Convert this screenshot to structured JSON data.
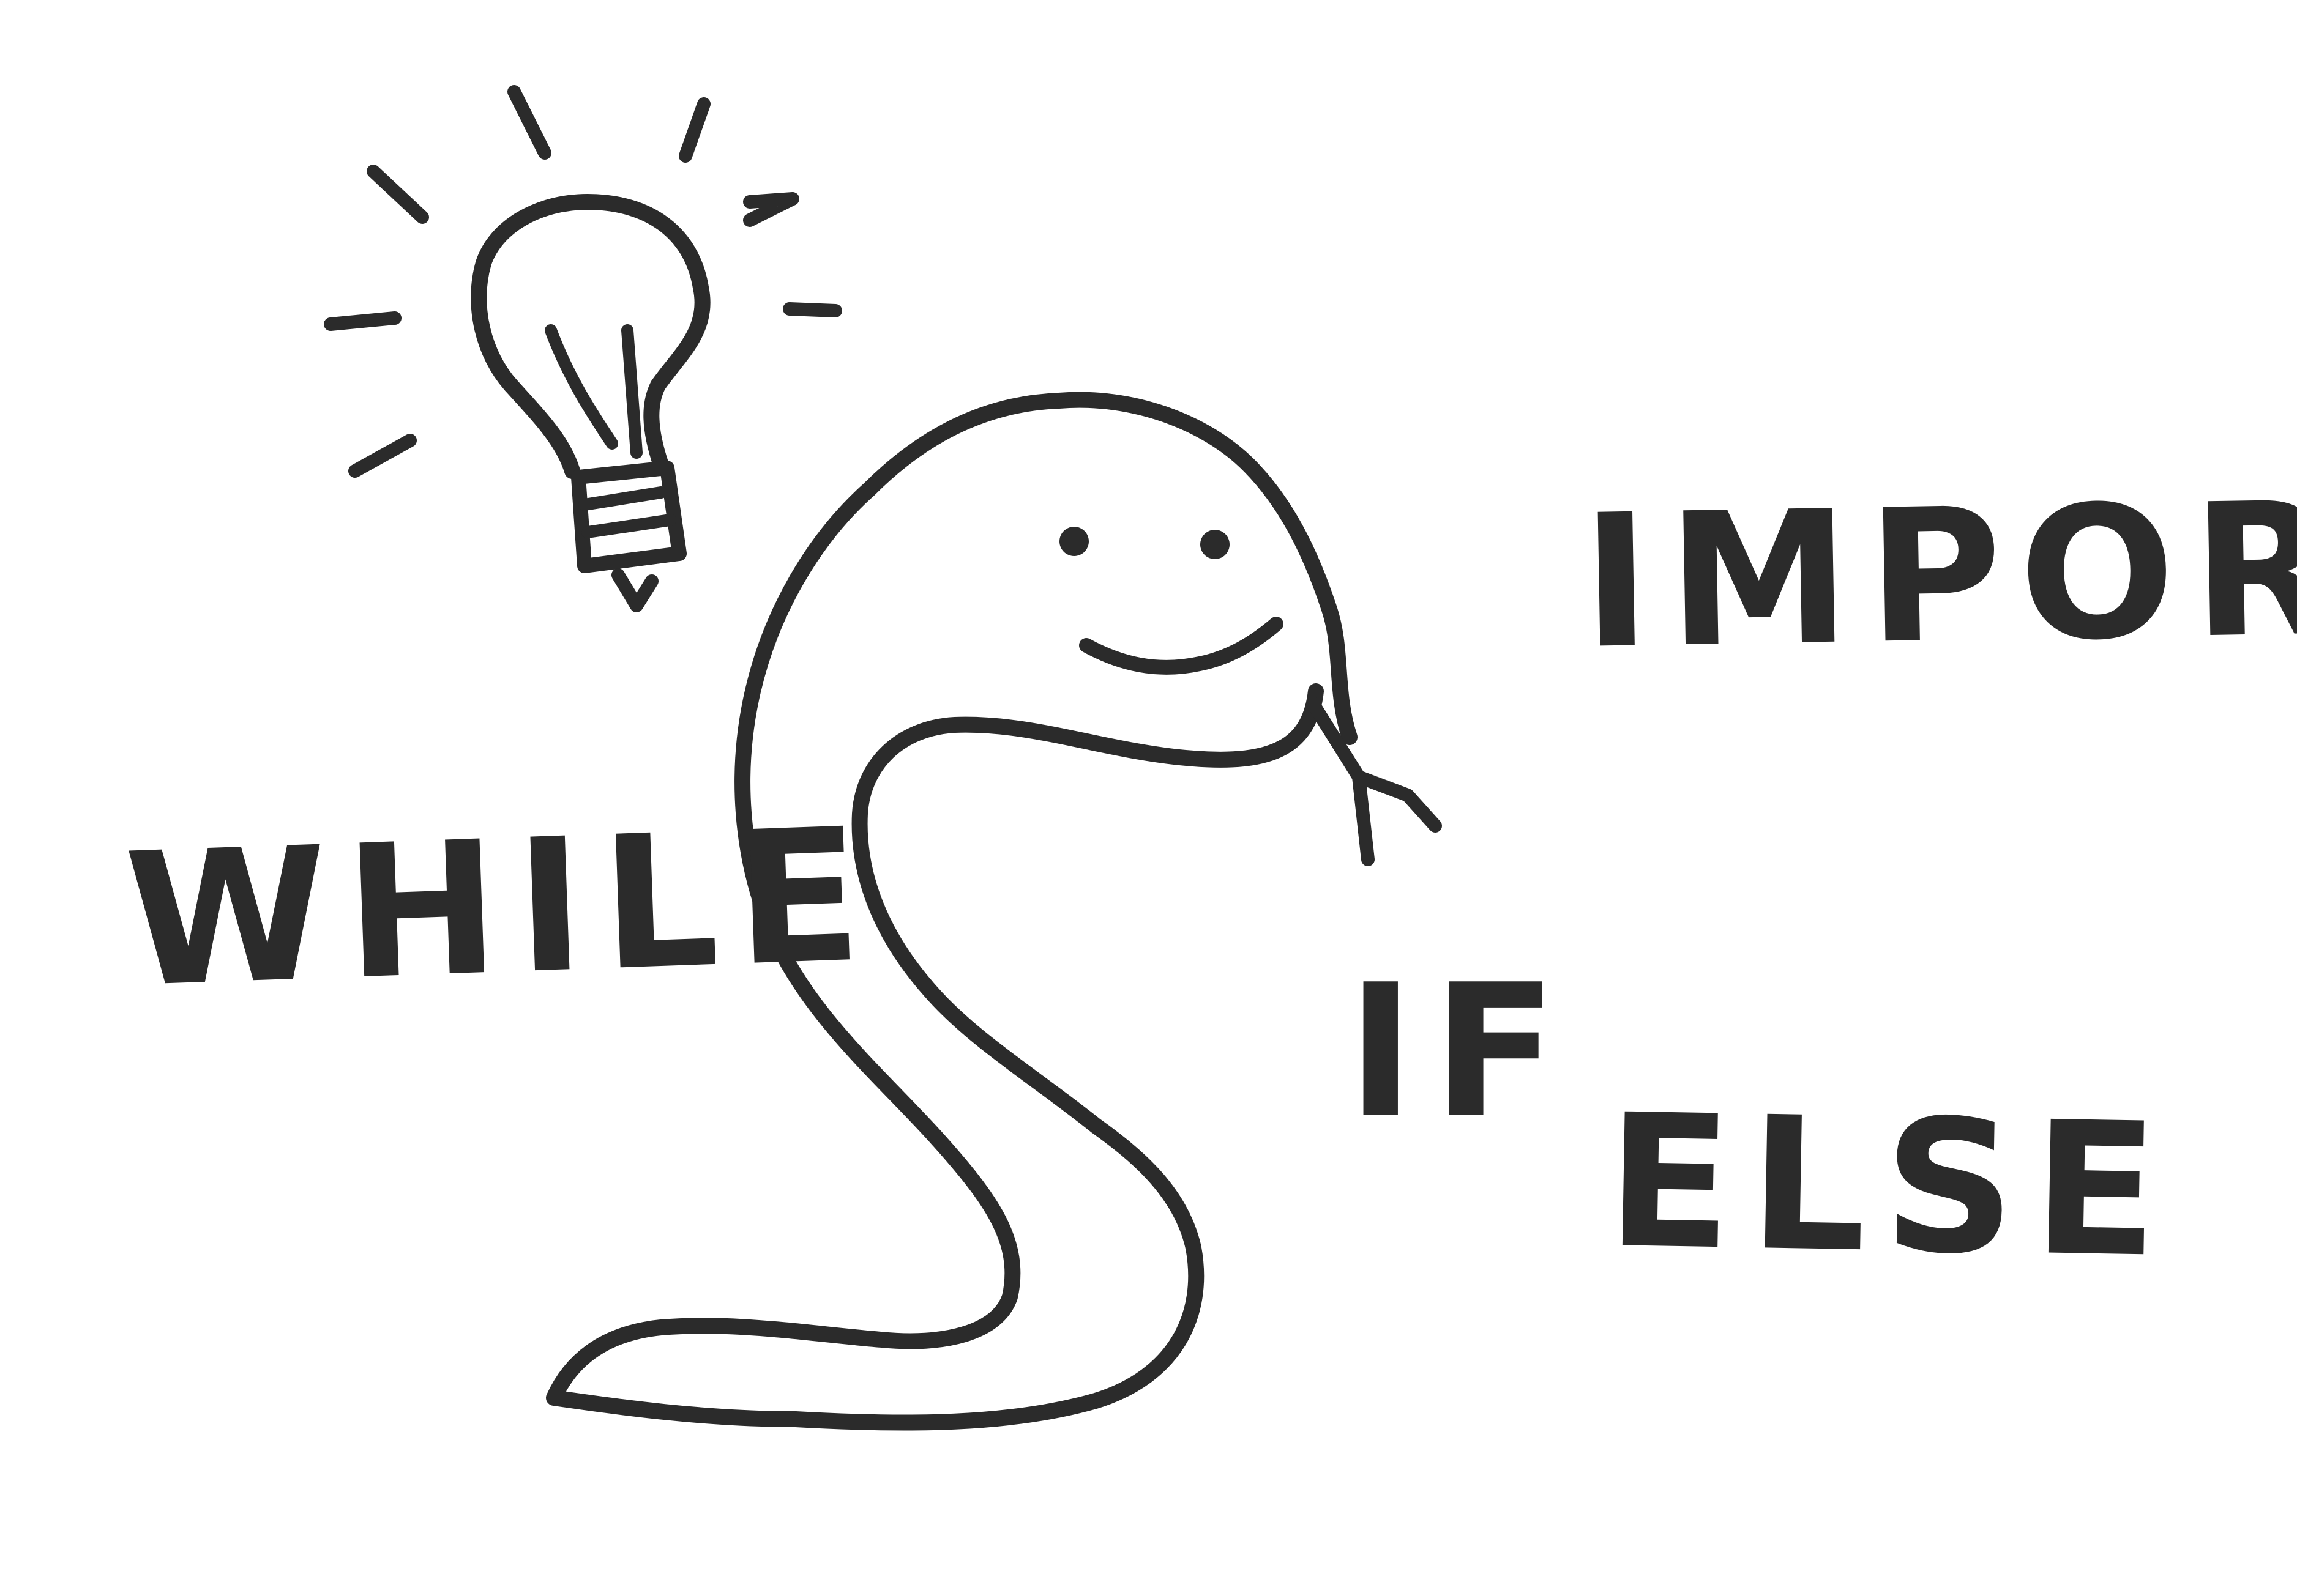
{
  "colors": {
    "ink": "#2b2b2b",
    "background": "#ffffff"
  },
  "illustration": {
    "icons": [
      "python-snake-icon",
      "lightbulb-icon"
    ]
  },
  "keywords": {
    "while": "WHILE",
    "import": "IMPORT",
    "if": "IF",
    "else": "ELSE"
  }
}
